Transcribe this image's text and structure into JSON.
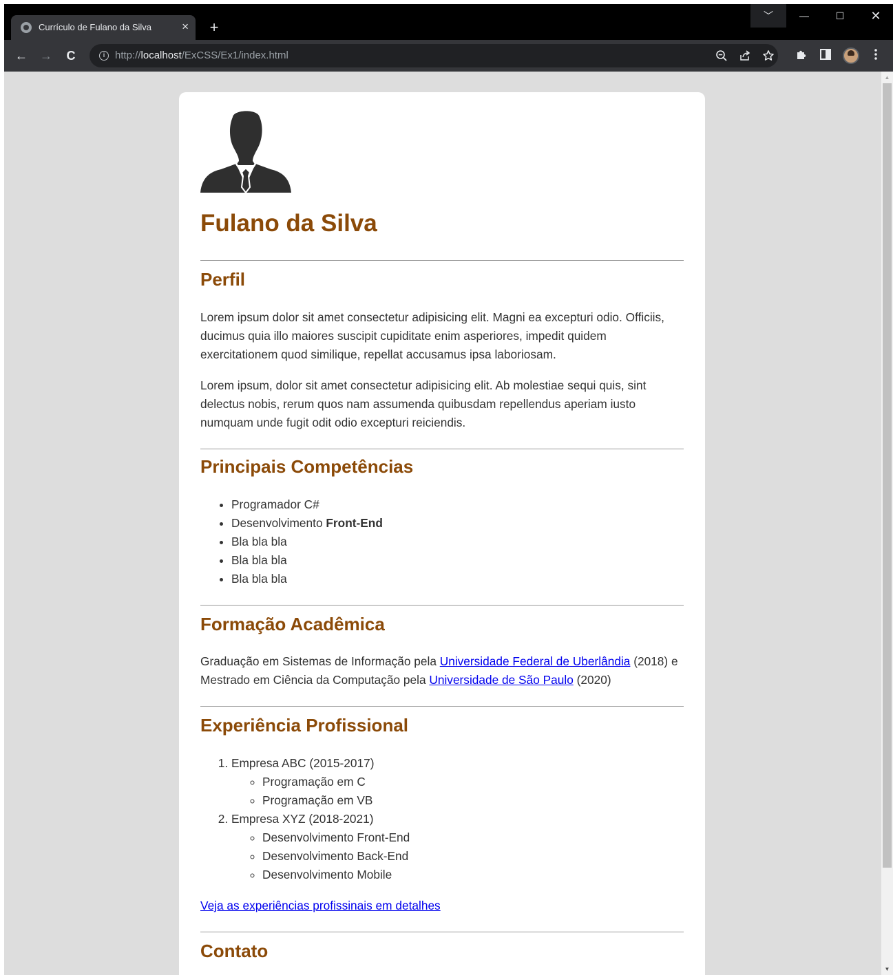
{
  "browser": {
    "tab_title": "Currículo de Fulano da Silva",
    "tab_close": "×",
    "new_tab": "+",
    "url_scheme": "http://",
    "url_host": "localhost",
    "url_path": "/ExCSS/Ex1/index.html",
    "window_controls": {
      "dropdown": "﹀",
      "minimize": "—",
      "maximize": "☐",
      "close": "✕"
    },
    "nav": {
      "back": "←",
      "forward": "→",
      "reload": "C"
    },
    "icons": [
      "zoom-out-icon",
      "share-icon",
      "star-icon",
      "extensions-icon",
      "side-panel-icon",
      "profile-avatar",
      "menu-icon"
    ]
  },
  "resume": {
    "name": "Fulano da Silva",
    "accent_color": "#8b4a08",
    "profile": {
      "heading": "Perfil",
      "paragraphs": [
        "Lorem ipsum dolor sit amet consectetur adipisicing elit. Magni ea excepturi odio. Officiis, ducimus quia illo maiores suscipit cupiditate enim asperiores, impedit quidem exercitationem quod similique, repellat accusamus ipsa laboriosam.",
        "Lorem ipsum, dolor sit amet consectetur adipisicing elit. Ab molestiae sequi quis, sint delectus nobis, rerum quos nam assumenda quibusdam repellendus aperiam iusto numquam unde fugit odit odio excepturi reiciendis."
      ]
    },
    "skills": {
      "heading": "Principais Competências",
      "item1": "Programador C#",
      "item2_prefix": "Desenvolvimento ",
      "item2_bold": "Front-End",
      "item3": "Bla bla bla",
      "item4": "Bla bla bla",
      "item5": "Bla bla bla"
    },
    "education": {
      "heading": "Formação Acadêmica",
      "text1": "Graduação em Sistemas de Informação pela ",
      "link1": "Universidade Federal de Uberlândia",
      "text2": " (2018) e Mestrado em Ciência da Computação pela ",
      "link2": "Universidade de São Paulo",
      "text3": " (2020)"
    },
    "experience": {
      "heading": "Experiência Profissional",
      "jobs": [
        {
          "title": "Empresa ABC (2015-2017)",
          "tasks": [
            "Programação em C",
            "Programação em VB"
          ]
        },
        {
          "title": "Empresa XYZ (2018-2021)",
          "tasks": [
            "Desenvolvimento Front-End",
            "Desenvolvimento Back-End",
            "Desenvolvimento Mobile"
          ]
        }
      ],
      "details_link": "Veja as experiências profissinais em detalhes"
    },
    "contact": {
      "heading": "Contato"
    }
  }
}
